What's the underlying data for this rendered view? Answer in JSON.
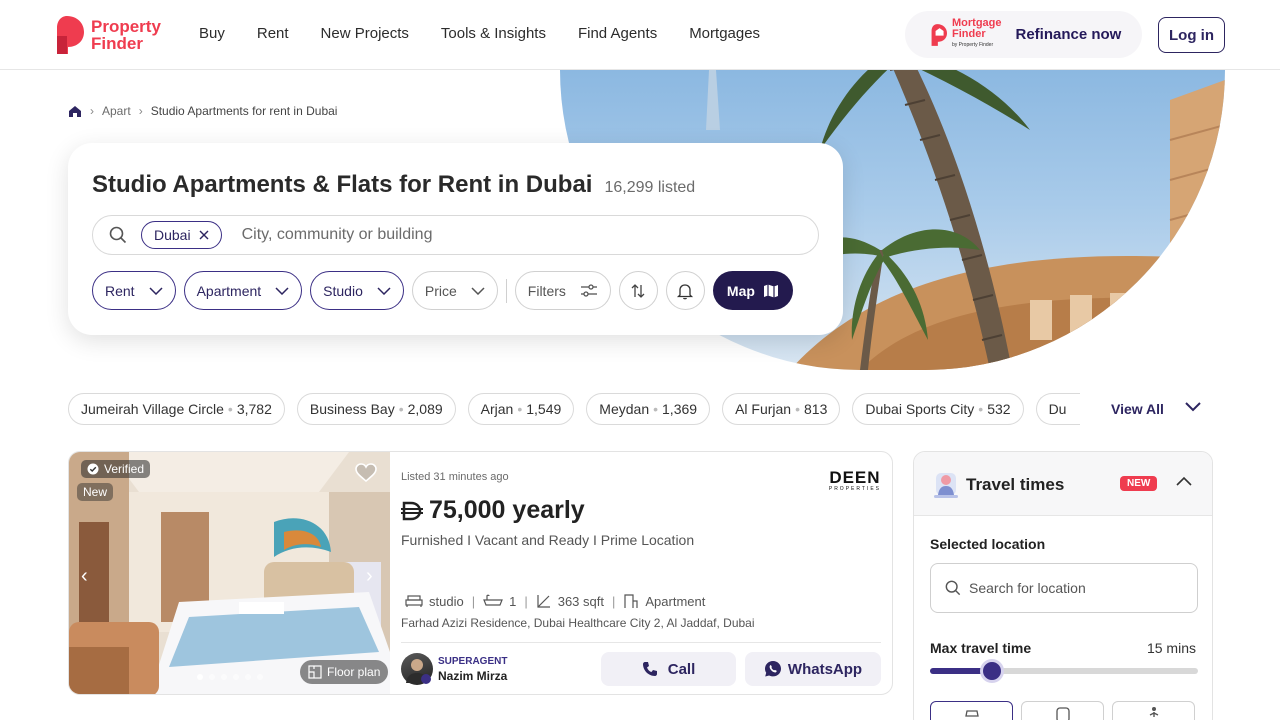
{
  "header": {
    "logo": {
      "line1": "Property",
      "line2": "Finder"
    },
    "nav": [
      "Buy",
      "Rent",
      "New Projects",
      "Tools & Insights",
      "Find Agents",
      "Mortgages"
    ],
    "mortgage": {
      "line1": "Mortgage",
      "line2": "Finder",
      "by": "by Property Finder",
      "cta": "Refinance now"
    },
    "login": "Log in",
    "brand_color": "#ef3c4f",
    "accent_color": "#2d2560"
  },
  "breadcrumb": {
    "items": [
      "Apart",
      "Studio Apartments for rent in Dubai"
    ]
  },
  "search": {
    "title": "Studio Apartments & Flats for Rent in Dubai",
    "count": "16,299 listed",
    "chip": "Dubai",
    "placeholder": "City, community or building",
    "filters": {
      "rent": "Rent",
      "type": "Apartment",
      "beds": "Studio",
      "price": "Price",
      "more": "Filters",
      "map": "Map"
    }
  },
  "locations": [
    {
      "name": "Jumeirah Village Circle",
      "count": "3,782"
    },
    {
      "name": "Business Bay",
      "count": "2,089"
    },
    {
      "name": "Arjan",
      "count": "1,549"
    },
    {
      "name": "Meydan",
      "count": "1,369"
    },
    {
      "name": "Al Furjan",
      "count": "813"
    },
    {
      "name": "Dubai Sports City",
      "count": "532"
    },
    {
      "name": "Du",
      "count": ""
    }
  ],
  "view_all": "View All",
  "listing": {
    "verified": "Verified",
    "new": "New",
    "floor_plan": "Floor plan",
    "listed_time": "Listed 31 minutes ago",
    "agency": {
      "line1": "DEEN",
      "line2": "PROPERTIES"
    },
    "price": "75,000 yearly",
    "subtitle": "Furnished I Vacant and Ready I Prime Location",
    "beds": "studio",
    "baths": "1",
    "area": "363 sqft",
    "type": "Apartment",
    "address": "Farhad Azizi Residence, Dubai Healthcare City 2, Al Jaddaf, Dubai",
    "agent_badge": "SUPERAGENT",
    "agent_name": "Nazim Mirza",
    "call": "Call",
    "whatsapp": "WhatsApp",
    "photo_index": 1,
    "photo_count": 6
  },
  "travel": {
    "title": "Travel times",
    "badge": "NEW",
    "selected_label": "Selected location",
    "search_placeholder": "Search for location",
    "max_label": "Max travel time",
    "max_value": "15 mins",
    "slider_fraction": 0.23
  }
}
